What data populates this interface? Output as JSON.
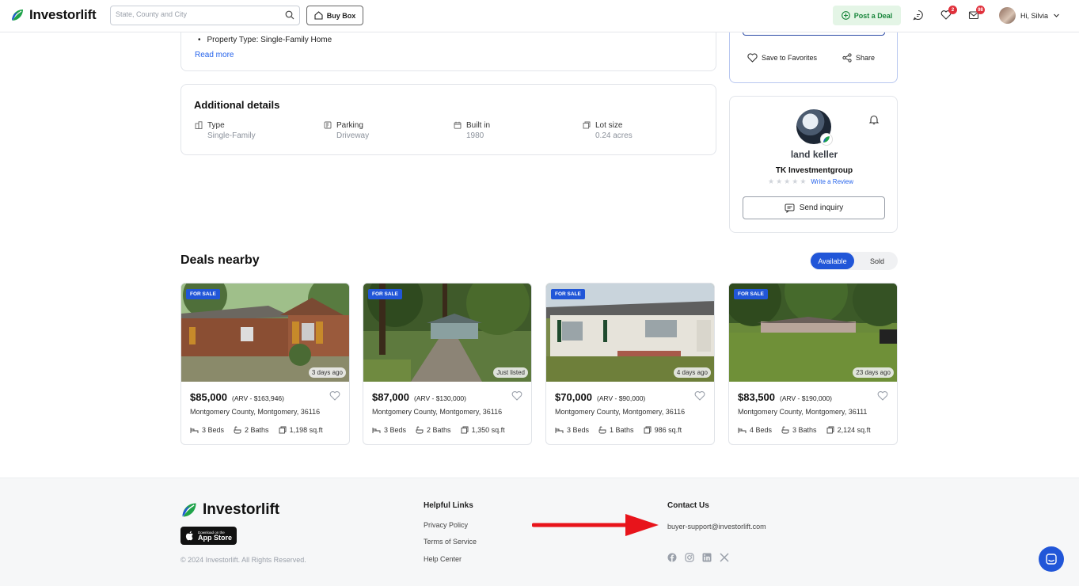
{
  "header": {
    "logo_text": "Investorlift",
    "search_placeholder": "State, County and City",
    "buy_box_label": "Buy Box",
    "post_deal_label": "Post a Deal",
    "favorites_badge": "2",
    "messages_badge": "98",
    "user_greeting": "Hi, Silvia"
  },
  "description": {
    "bullet": "Property Type: Single-Family Home",
    "read_more": "Read more"
  },
  "additional_details": {
    "title": "Additional details",
    "items": [
      {
        "label": "Type",
        "value": "Single-Family",
        "icon": "building-icon"
      },
      {
        "label": "Parking",
        "value": "Driveway",
        "icon": "parking-icon"
      },
      {
        "label": "Built in",
        "value": "1980",
        "icon": "calendar-icon"
      },
      {
        "label": "Lot size",
        "value": "0.24 acres",
        "icon": "lot-size-icon"
      }
    ]
  },
  "actions": {
    "save_favorites": "Save to Favorites",
    "share": "Share"
  },
  "agent": {
    "name": "land keller",
    "company": "TK Investmentgroup",
    "write_review": "Write a Review",
    "send_inquiry": "Send inquiry",
    "rating": 0
  },
  "deals": {
    "title": "Deals nearby",
    "toggle_available": "Available",
    "toggle_sold": "Sold",
    "listings": [
      {
        "tag": "FOR SALE",
        "age": "3 days ago",
        "price": "$85,000",
        "arv": "(ARV - $163,946)",
        "location": "Montgomery County, Montgomery, 36116",
        "beds": "3 Beds",
        "baths": "2 Baths",
        "sqft": "1,198 sq.ft"
      },
      {
        "tag": "FOR SALE",
        "age": "Just listed",
        "price": "$87,000",
        "arv": "(ARV - $130,000)",
        "location": "Montgomery County, Montgomery, 36116",
        "beds": "3 Beds",
        "baths": "2 Baths",
        "sqft": "1,350 sq.ft"
      },
      {
        "tag": "FOR SALE",
        "age": "4 days ago",
        "price": "$70,000",
        "arv": "(ARV - $90,000)",
        "location": "Montgomery County, Montgomery, 36116",
        "beds": "3 Beds",
        "baths": "1 Baths",
        "sqft": "986 sq.ft"
      },
      {
        "tag": "FOR SALE",
        "age": "23 days ago",
        "price": "$83,500",
        "arv": "(ARV - $190,000)",
        "location": "Montgomery County, Montgomery, 36111",
        "beds": "4 Beds",
        "baths": "3 Baths",
        "sqft": "2,124 sq.ft"
      }
    ]
  },
  "footer": {
    "logo_text": "Investorlift",
    "app_store_small": "Download on the",
    "app_store_big": "App Store",
    "copyright": "© 2024 Investorlift. All Rights Reserved.",
    "helpful_links_title": "Helpful Links",
    "links": [
      "Privacy Policy",
      "Terms of Service",
      "Help Center"
    ],
    "contact_title": "Contact Us",
    "contact_email": "buyer-support@investorlift.com",
    "socials": [
      "facebook-icon",
      "instagram-icon",
      "linkedin-icon",
      "x-icon"
    ]
  },
  "colors": {
    "accent": "#2156d8",
    "post_deal_bg": "#e4f5e6",
    "post_deal_text": "#17853a",
    "badge": "#e0313c",
    "annotation_arrow": "#e8141b"
  }
}
